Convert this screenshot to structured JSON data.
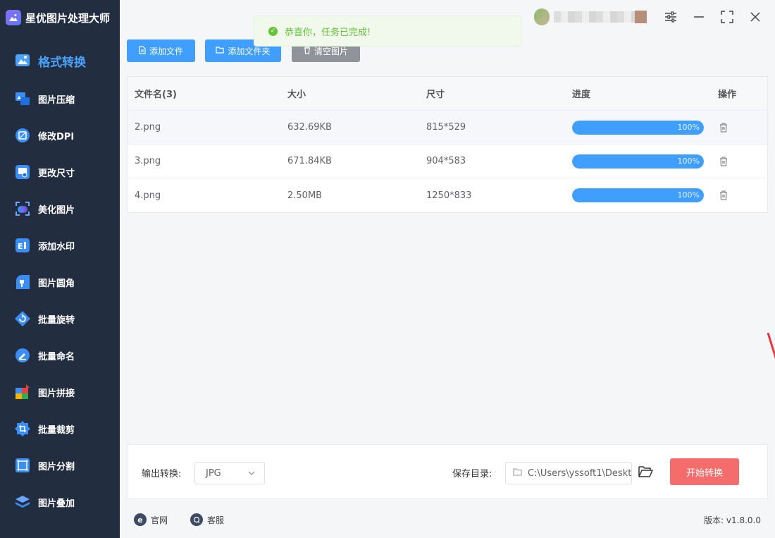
{
  "app": {
    "title": "星优图片处理大师"
  },
  "sidebar": {
    "items": [
      {
        "label": "格式转换",
        "icon": "image-convert-icon",
        "active": true
      },
      {
        "label": "图片压缩",
        "icon": "image-compress-icon"
      },
      {
        "label": "修改DPI",
        "icon": "dpi-icon"
      },
      {
        "label": "更改尺寸",
        "icon": "resize-icon"
      },
      {
        "label": "美化图片",
        "icon": "beautify-icon"
      },
      {
        "label": "添加水印",
        "icon": "watermark-icon"
      },
      {
        "label": "图片圆角",
        "icon": "rounded-corner-icon"
      },
      {
        "label": "批量旋转",
        "icon": "rotate-icon"
      },
      {
        "label": "批量命名",
        "icon": "rename-icon"
      },
      {
        "label": "图片拼接",
        "icon": "stitch-icon"
      },
      {
        "label": "批量裁剪",
        "icon": "crop-icon"
      },
      {
        "label": "图片分割",
        "icon": "split-icon"
      },
      {
        "label": "图片叠加",
        "icon": "layers-icon"
      }
    ]
  },
  "toast": {
    "message": "恭喜你，任务已完成!"
  },
  "toolbar": {
    "add_file": "添加文件",
    "add_folder": "添加文件夹",
    "clear": "清空图片"
  },
  "table": {
    "headers": {
      "name": "文件名(3)",
      "size": "大小",
      "dimensions": "尺寸",
      "progress": "进度",
      "action": "操作"
    },
    "rows": [
      {
        "name": "2.png",
        "size": "632.69KB",
        "dimensions": "815*529",
        "progress": 1.0,
        "progress_label": "100%"
      },
      {
        "name": "3.png",
        "size": "671.84KB",
        "dimensions": "904*583",
        "progress": 1.0,
        "progress_label": "100%"
      },
      {
        "name": "4.png",
        "size": "2.50MB",
        "dimensions": "1250*833",
        "progress": 1.0,
        "progress_label": "100%"
      }
    ]
  },
  "bottom": {
    "output_label": "输出转换:",
    "output_value": "JPG",
    "save_label": "保存目录:",
    "save_path": "C:\\Users\\yssoft1\\Deskt",
    "start_button": "开始转换"
  },
  "footer": {
    "website": "官网",
    "support": "客服",
    "version": "版本: v1.8.0.0"
  },
  "colors": {
    "sidebar_bg": "#232d40",
    "accent": "#409eff",
    "start": "#f56c6c",
    "success": "#67c23a"
  }
}
